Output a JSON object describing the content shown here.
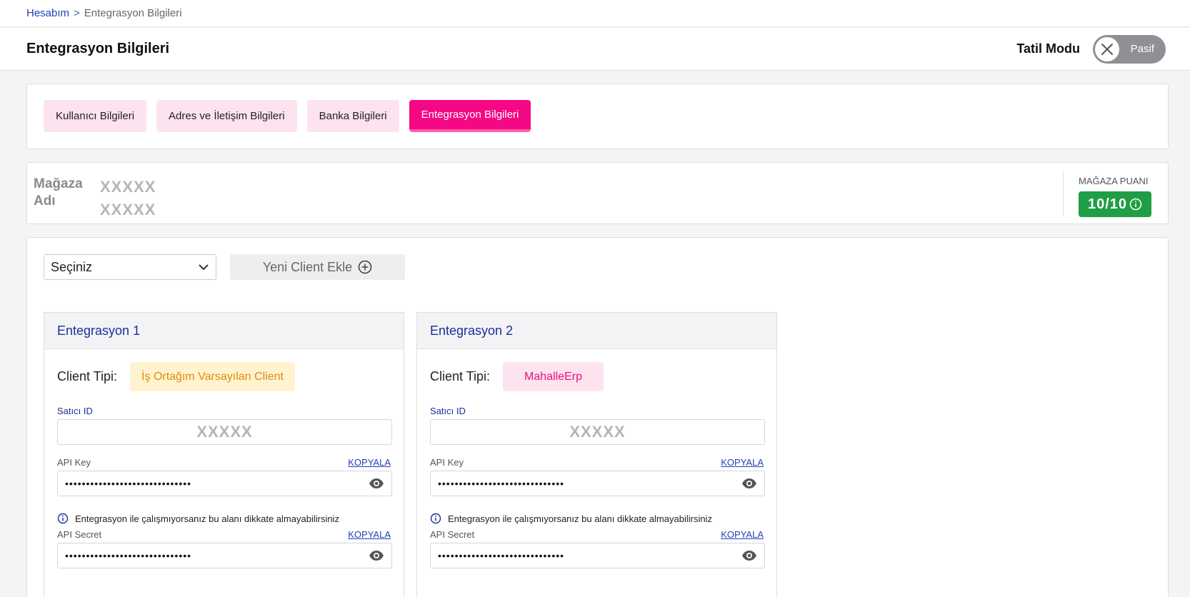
{
  "breadcrumb": {
    "home": "Hesabım",
    "separator": ">",
    "current": "Entegrasyon Bilgileri"
  },
  "header": {
    "title": "Entegrasyon Bilgileri",
    "vacation_label": "Tatil Modu",
    "vacation_state": "Pasif"
  },
  "tabs": [
    {
      "label": "Kullanıcı Bilgileri",
      "active": false
    },
    {
      "label": "Adres ve İletişim Bilgileri",
      "active": false
    },
    {
      "label": "Banka Bilgileri",
      "active": false
    },
    {
      "label": "Entegrasyon Bilgileri",
      "active": true
    }
  ],
  "store": {
    "logo_text": "Mağaza Adı",
    "name": "XXXXX XXXXX",
    "score_label": "MAĞAZA PUANI",
    "score": "10/10"
  },
  "controls": {
    "select_value": "Seçiniz",
    "add_client": "Yeni Client Ekle"
  },
  "integrations": [
    {
      "title": "Entegrasyon 1",
      "client_type_label": "Client Tipi:",
      "client_type": "İş Ortağım Varsayılan Client",
      "seller_id_label": "Satıcı ID",
      "seller_id": "XXXXX",
      "api_key_label": "API Key",
      "api_key": "••••••••••••••••••••••••••••••",
      "copy_label": "KOPYALA",
      "info_text": "Entegrasyon ile çalışmıyorsanız bu alanı dikkate almayabilirsiniz",
      "api_secret_label": "API Secret",
      "api_secret": "••••••••••••••••••••••••••••••"
    },
    {
      "title": "Entegrasyon 2",
      "client_type_label": "Client Tipi:",
      "client_type": "MahalleErp",
      "seller_id_label": "Satıcı ID",
      "seller_id": "XXXXX",
      "api_key_label": "API Key",
      "api_key": "••••••••••••••••••••••••••••••",
      "copy_label": "KOPYALA",
      "info_text": "Entegrasyon ile çalışmıyorsanız bu alanı dikkate almayabilirsiniz",
      "api_secret_label": "API Secret",
      "api_secret": "••••••••••••••••••••••••••••••"
    }
  ],
  "colors": {
    "brand_pink": "#f50884",
    "tab_pink_light": "#fde3f0",
    "link_blue": "#1f3fb8",
    "score_green": "#1f9e45",
    "badge_yellow_bg": "#fff3cf",
    "badge_yellow_text": "#e08b10"
  }
}
